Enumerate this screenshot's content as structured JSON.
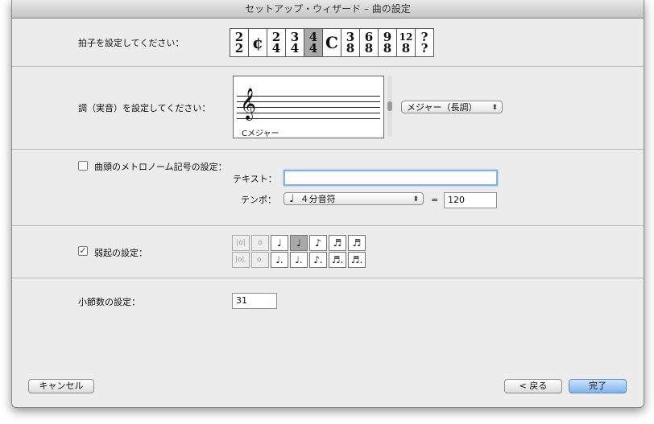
{
  "window": {
    "title": "セットアップ・ウィザード – 曲の設定"
  },
  "time_signature": {
    "label": "拍子を設定してください：",
    "options": [
      {
        "top": "2",
        "bottom": "2",
        "single": ""
      },
      {
        "top": "",
        "bottom": "",
        "single": "¢"
      },
      {
        "top": "2",
        "bottom": "4",
        "single": ""
      },
      {
        "top": "3",
        "bottom": "4",
        "single": ""
      },
      {
        "top": "4",
        "bottom": "4",
        "single": ""
      },
      {
        "top": "",
        "bottom": "",
        "single": "C"
      },
      {
        "top": "3",
        "bottom": "8",
        "single": ""
      },
      {
        "top": "6",
        "bottom": "8",
        "single": ""
      },
      {
        "top": "9",
        "bottom": "8",
        "single": ""
      },
      {
        "top": "12",
        "bottom": "8",
        "single": ""
      },
      {
        "top": "?",
        "bottom": "?",
        "single": ""
      }
    ],
    "selected_index": 4
  },
  "key": {
    "label": "調（実音）を設定してください：",
    "caption": "Cメジャー",
    "mode_value": "メジャー（長調）"
  },
  "metronome": {
    "label": "曲頭のメトロノーム記号の設定：",
    "checked": false,
    "text_label": "テキスト：",
    "text_value": "",
    "tempo_label": "テンポ：",
    "note_value": "４分音符",
    "equals": "=",
    "bpm": "120"
  },
  "pickup": {
    "label": "弱起の設定：",
    "checked": true,
    "row1": [
      "|o|",
      "o",
      "♩",
      "♩",
      "♪",
      "♬",
      "♬"
    ],
    "row2": [
      "|o|.",
      "o.",
      "♩.",
      "♩.",
      "♪.",
      "♬.",
      "♬."
    ],
    "selected_row": 0,
    "selected_index": 3
  },
  "measures": {
    "label": "小節数の設定：",
    "value": "31"
  },
  "buttons": {
    "cancel": "キャンセル",
    "back": "< 戻る",
    "finish": "完了"
  }
}
